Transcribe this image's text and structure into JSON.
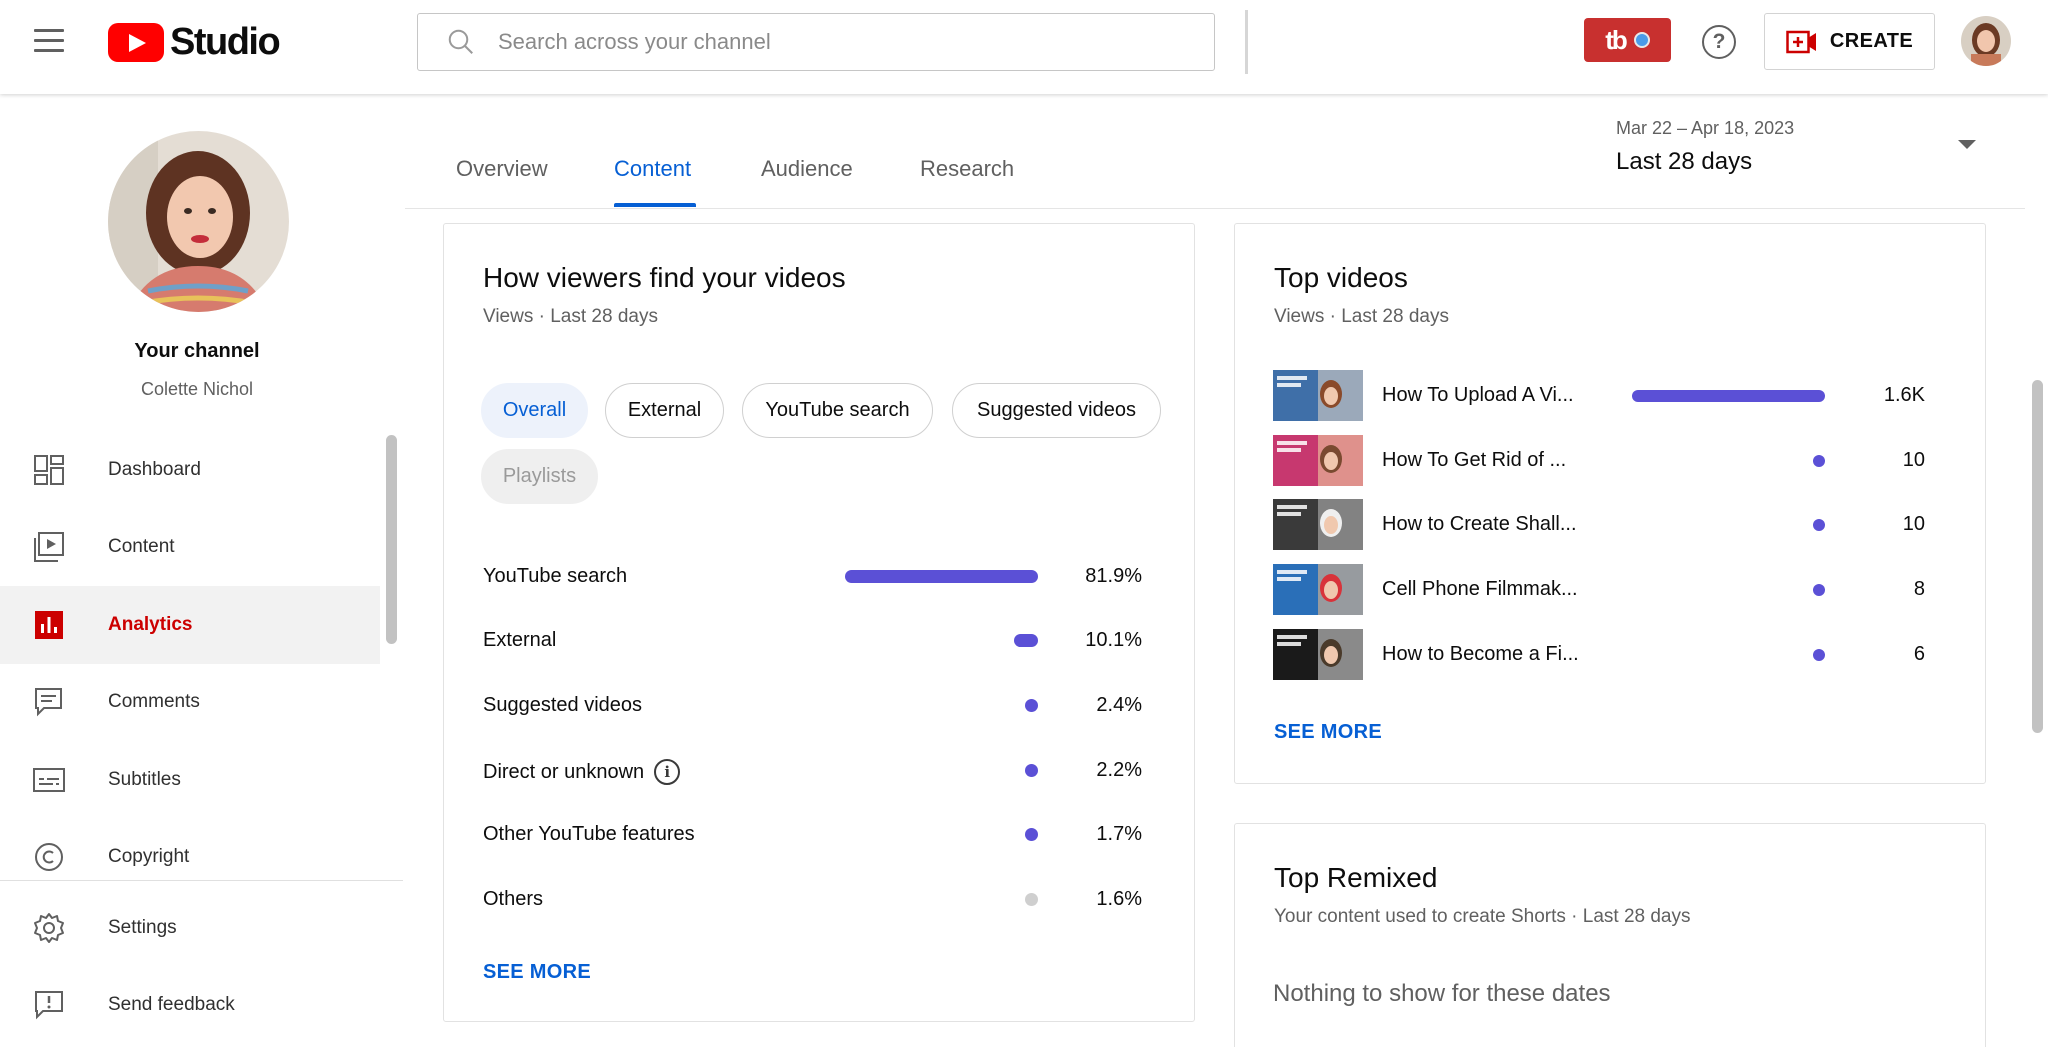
{
  "header": {
    "logo_text": "Studio",
    "search_placeholder": "Search across your channel",
    "tubebuddy_label": "tb",
    "help_label": "?",
    "create_label": "CREATE"
  },
  "sidebar": {
    "channel_title": "Your channel",
    "channel_name": "Colette Nichol",
    "items": [
      {
        "label": "Dashboard",
        "icon": "dashboard-icon"
      },
      {
        "label": "Content",
        "icon": "content-icon"
      },
      {
        "label": "Analytics",
        "icon": "analytics-icon",
        "active": true
      },
      {
        "label": "Comments",
        "icon": "comments-icon"
      },
      {
        "label": "Subtitles",
        "icon": "subtitles-icon"
      },
      {
        "label": "Copyright",
        "icon": "copyright-icon"
      }
    ],
    "bottom_items": [
      {
        "label": "Settings",
        "icon": "settings-icon"
      },
      {
        "label": "Send feedback",
        "icon": "feedback-icon"
      }
    ]
  },
  "tabs": {
    "items": [
      "Overview",
      "Content",
      "Audience",
      "Research"
    ],
    "active": "Content"
  },
  "date_selector": {
    "range": "Mar 22 – Apr 18, 2023",
    "label": "Last 28 days"
  },
  "traffic_card": {
    "title": "How viewers find your videos",
    "subtitle": "Views · Last 28 days",
    "chips": [
      {
        "label": "Overall",
        "state": "selected"
      },
      {
        "label": "External",
        "state": "normal"
      },
      {
        "label": "YouTube search",
        "state": "normal"
      },
      {
        "label": "Suggested videos",
        "state": "normal"
      },
      {
        "label": "Playlists",
        "state": "disabled"
      }
    ],
    "sources": [
      {
        "label": "YouTube search",
        "value": "81.9%",
        "share": 0.819,
        "color": "#5b50d6"
      },
      {
        "label": "External",
        "value": "10.1%",
        "share": 0.101,
        "color": "#5b50d6"
      },
      {
        "label": "Suggested videos",
        "value": "2.4%",
        "share": 0.024,
        "color": "#5b50d6"
      },
      {
        "label": "Direct or unknown",
        "value": "2.2%",
        "share": 0.022,
        "color": "#5b50d6",
        "info": true
      },
      {
        "label": "Other YouTube features",
        "value": "1.7%",
        "share": 0.017,
        "color": "#5b50d6"
      },
      {
        "label": "Others",
        "value": "1.6%",
        "share": 0.016,
        "color": "#cfcfcf"
      }
    ],
    "see_more": "SEE MORE"
  },
  "top_videos": {
    "title": "Top videos",
    "subtitle": "Views · Last 28 days",
    "videos": [
      {
        "title": "How To Upload A Vi...",
        "value": "1.6K",
        "views": 1600
      },
      {
        "title": "How To Get Rid of ...",
        "value": "10",
        "views": 10
      },
      {
        "title": "How to Create Shall...",
        "value": "10",
        "views": 10
      },
      {
        "title": "Cell Phone Filmmak...",
        "value": "8",
        "views": 8
      },
      {
        "title": "How to Become a Fi...",
        "value": "6",
        "views": 6
      }
    ],
    "see_more": "SEE MORE"
  },
  "top_remixed": {
    "title": "Top Remixed",
    "subtitle": "Your content used to create Shorts · Last 28 days",
    "empty": "Nothing to show for these dates"
  }
}
